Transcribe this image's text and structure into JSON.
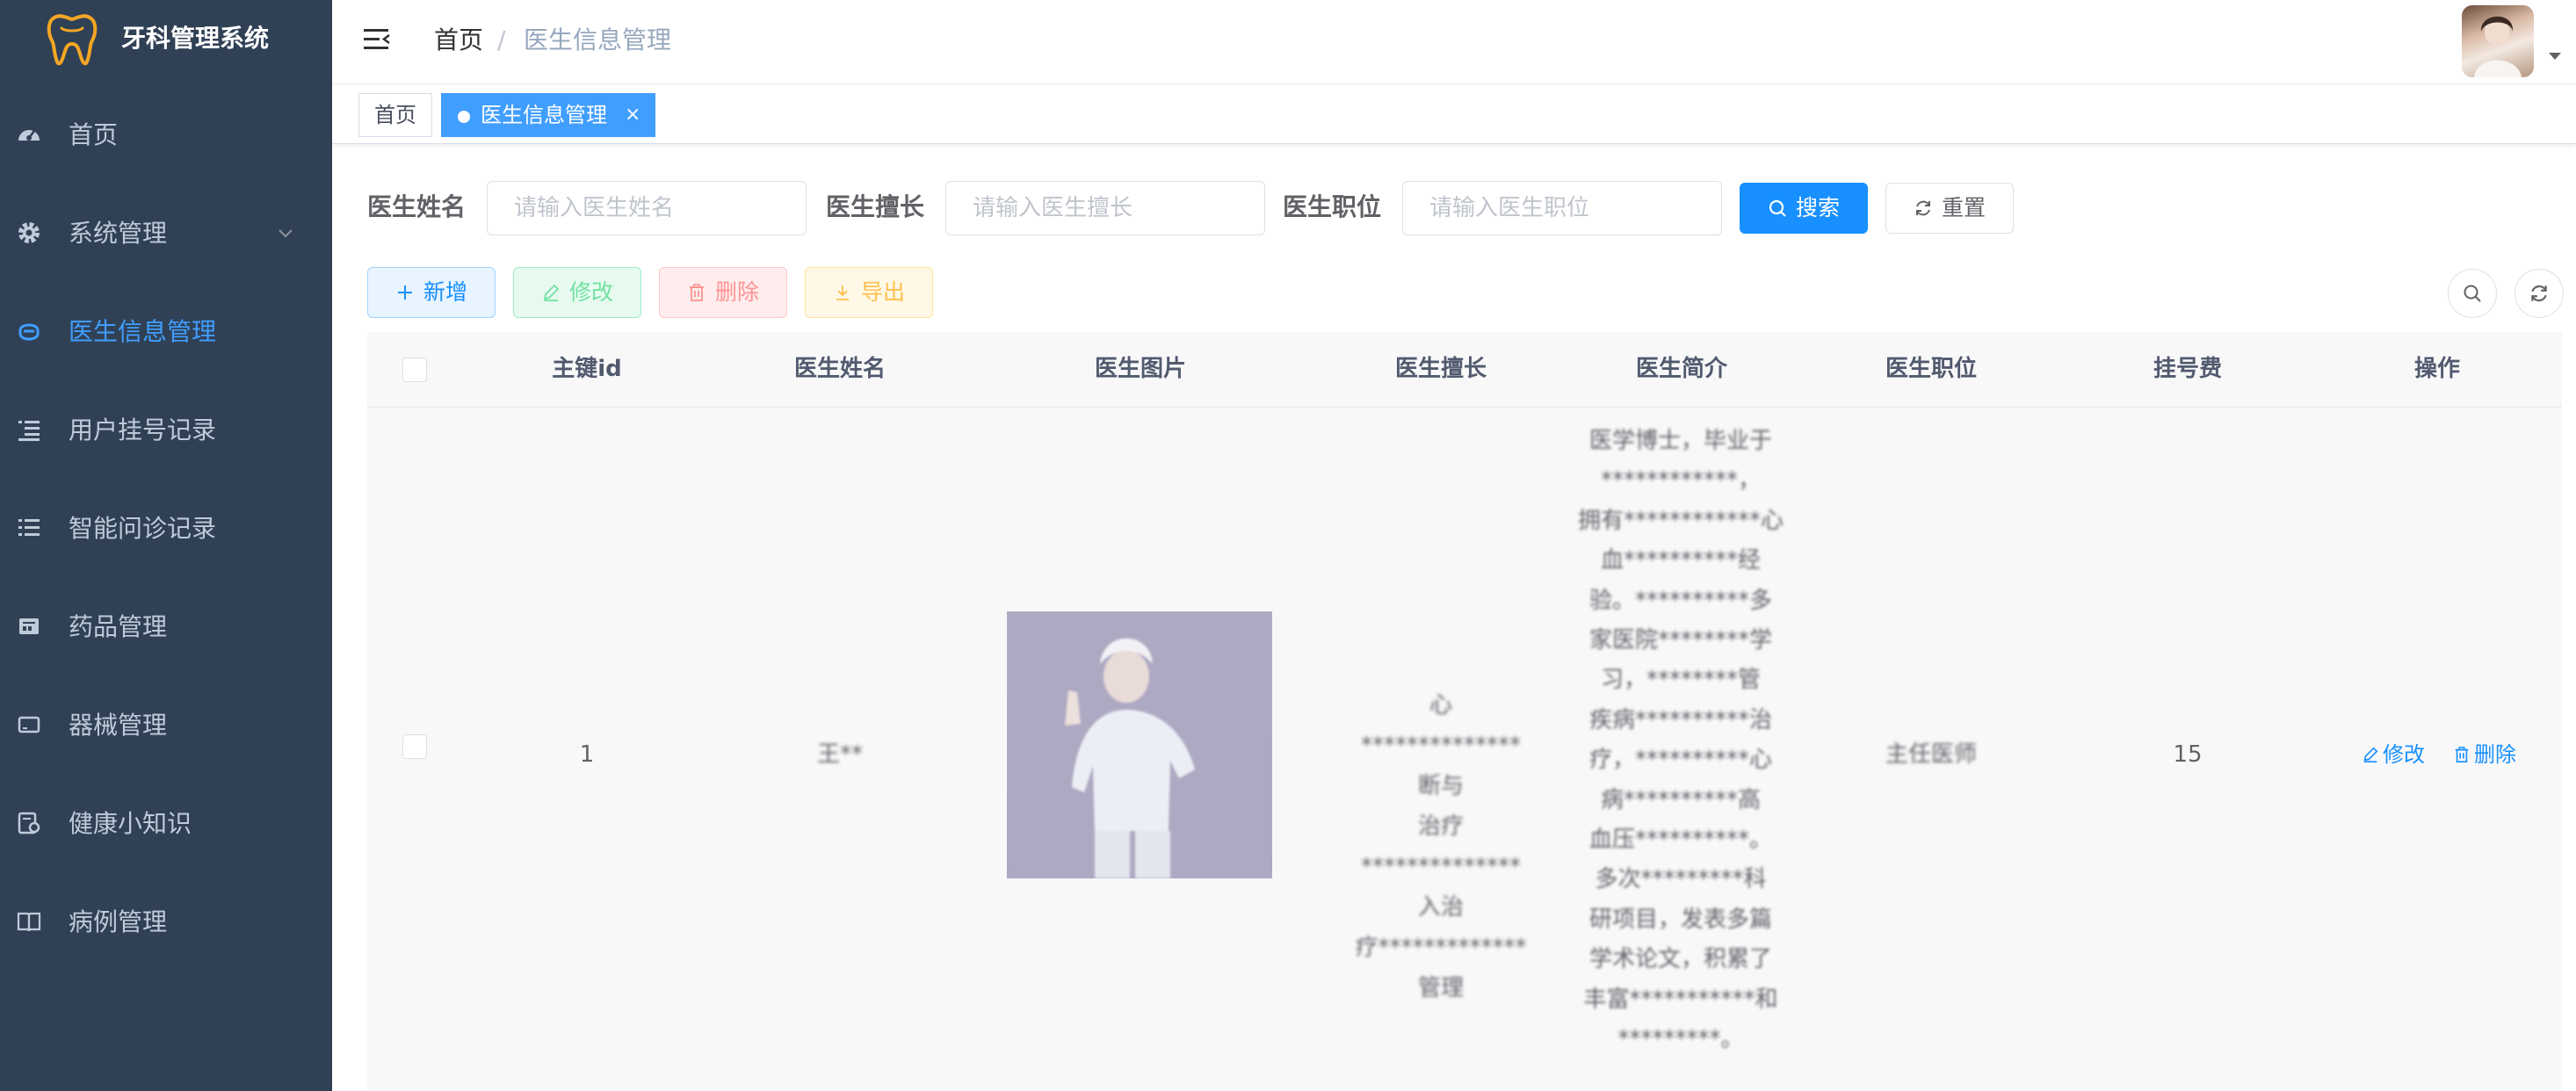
{
  "app": {
    "title": "牙科管理系统"
  },
  "sidebar": {
    "items": [
      {
        "label": "首页",
        "icon": "dashboard-icon"
      },
      {
        "label": "系统管理",
        "icon": "gear-icon"
      },
      {
        "label": "医生信息管理",
        "icon": "doctor-icon"
      },
      {
        "label": "用户挂号记录",
        "icon": "list-indent-icon"
      },
      {
        "label": "智能问诊记录",
        "icon": "list-icon"
      },
      {
        "label": "药品管理",
        "icon": "pdf-icon"
      },
      {
        "label": "器械管理",
        "icon": "device-icon"
      },
      {
        "label": "健康小知识",
        "icon": "knowledge-icon"
      },
      {
        "label": "病例管理",
        "icon": "book-icon"
      }
    ],
    "active_index": 2,
    "active_color": "#409eff",
    "background": "#304156"
  },
  "breadcrumb": {
    "home": "首页",
    "separator": "/",
    "current": "医生信息管理"
  },
  "tags": {
    "home": "首页",
    "active": "医生信息管理",
    "close": "×"
  },
  "search": {
    "name_label": "医生姓名",
    "name_placeholder": "请输入医生姓名",
    "specialty_label": "医生擅长",
    "specialty_placeholder": "请输入医生擅长",
    "title_label": "医生职位",
    "title_placeholder": "请输入医生职位",
    "search_button": "搜索",
    "reset_button": "重置"
  },
  "toolbar": {
    "add": "新增",
    "edit": "修改",
    "delete": "删除",
    "export": "导出"
  },
  "table": {
    "columns": [
      "主键id",
      "医生姓名",
      "医生图片",
      "医生擅长",
      "医生简介",
      "医生职位",
      "挂号费",
      "操作"
    ],
    "rows": [
      {
        "id": "1",
        "name": "王**",
        "specialty_lines": [
          "心**************断与",
          "治疗**************入治",
          "疗*************管理"
        ],
        "intro_lines": [
          "医学博士，毕业于",
          "************，",
          "拥有************心",
          "血**********经",
          "验。**********多",
          "家医院********学",
          "习，********管",
          "疾病**********治",
          "疗，**********心",
          "病**********高",
          "血压**********。",
          "多次*********科",
          "研项目，发表多篇",
          "学术论文，积累了",
          "丰富***********和",
          "*********。"
        ],
        "title": "主任医师",
        "fee": "15",
        "edit": "修改",
        "delete": "删除"
      }
    ]
  }
}
